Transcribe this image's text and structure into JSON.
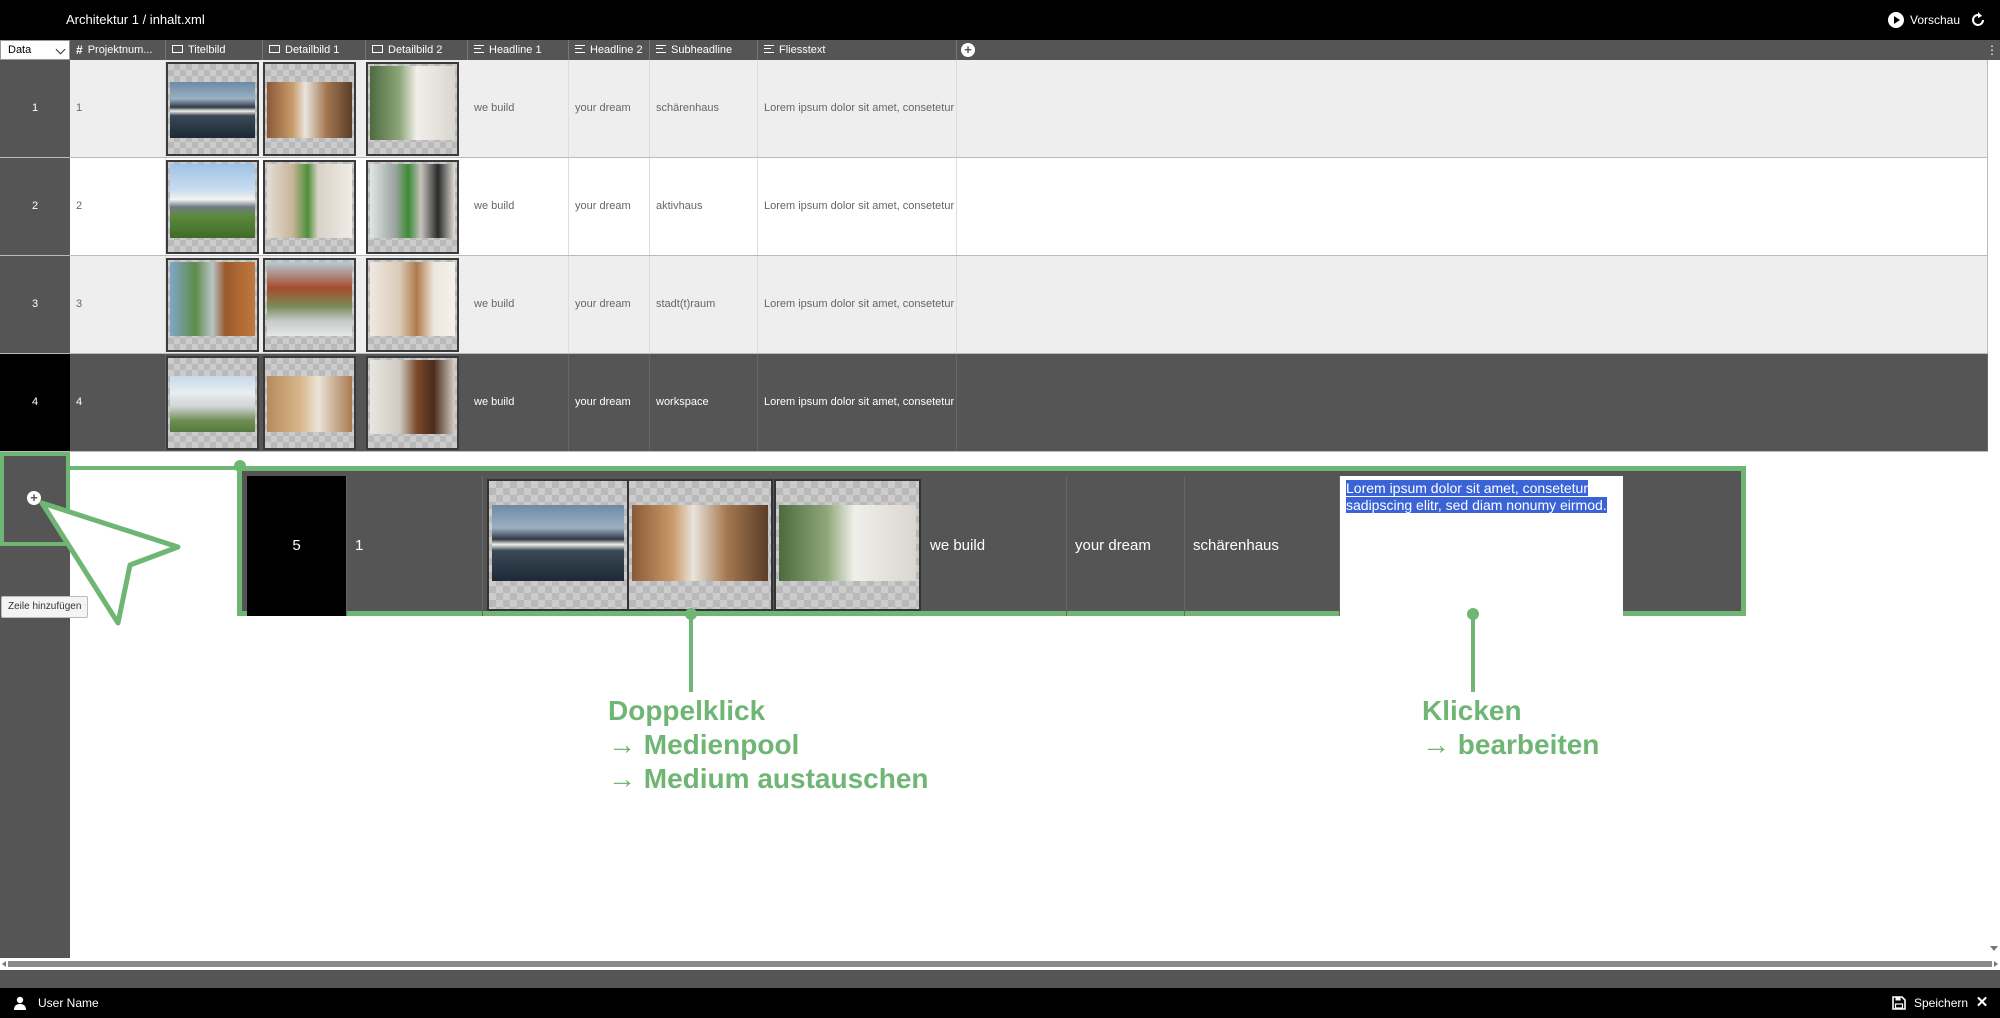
{
  "app": {
    "title": "Architektur 1 / inhalt.xml",
    "preview_label": "Vorschau"
  },
  "toolbar": {
    "data_select_value": "Data"
  },
  "columns": [
    {
      "label": "Projektnum...",
      "icon": "hash-icon"
    },
    {
      "label": "Titelbild",
      "icon": "image-icon"
    },
    {
      "label": "Detailbild 1",
      "icon": "image-icon"
    },
    {
      "label": "Detailbild 2",
      "icon": "image-icon"
    },
    {
      "label": "Headline 1",
      "icon": "text-icon"
    },
    {
      "label": "Headline 2",
      "icon": "text-icon"
    },
    {
      "label": "Subheadline",
      "icon": "text-icon"
    },
    {
      "label": "Fliesstext",
      "icon": "text-icon"
    }
  ],
  "rows": [
    {
      "index": "1",
      "projektnummer": "1",
      "headline1": "we build",
      "headline2": "your dream",
      "subheadline": "schärenhaus",
      "fliesstext": "Lorem ipsum dolor sit amet, consetetur sa",
      "selected": false
    },
    {
      "index": "2",
      "projektnummer": "2",
      "headline1": "we build",
      "headline2": "your dream",
      "subheadline": "aktivhaus",
      "fliesstext": "Lorem ipsum dolor sit amet, consetetur sa",
      "selected": false
    },
    {
      "index": "3",
      "projektnummer": "3",
      "headline1": "we build",
      "headline2": "your dream",
      "subheadline": "stadt(t)raum",
      "fliesstext": "Lorem ipsum dolor sit amet, consetetur sa",
      "selected": false
    },
    {
      "index": "4",
      "projektnummer": "4",
      "headline1": "we build",
      "headline2": "your dream",
      "subheadline": "workspace",
      "fliesstext": "Lorem ipsum dolor sit amet, consetetur sa",
      "selected": true
    }
  ],
  "add_row": {
    "tooltip": "Zeile hinzufügen"
  },
  "edit_row": {
    "index": "5",
    "projektnummer": "1",
    "headline1": "we build",
    "headline2": "your dream",
    "subheadline": "schärenhaus",
    "fliesstext_selected": "Lorem ipsum dolor sit amet, consetetur sadipscing elitr, sed diam nonumy eirmod."
  },
  "annotations": {
    "left": {
      "line1": "Doppelklick",
      "line2": "→ Medienpool",
      "line3": "→ Medium austauschen"
    },
    "right": {
      "line1": "Klicken",
      "line2": "→ bearbeiten"
    },
    "color": "#6fb674"
  },
  "footer": {
    "user_name": "User Name",
    "save_label": "Speichern"
  },
  "colors": {
    "topbar": "#000000",
    "panel": "#555555",
    "selected_row": "#555555",
    "row_alt": "#eeeeee",
    "highlight": "#6fb674",
    "text_selection": "#3b63d8"
  }
}
